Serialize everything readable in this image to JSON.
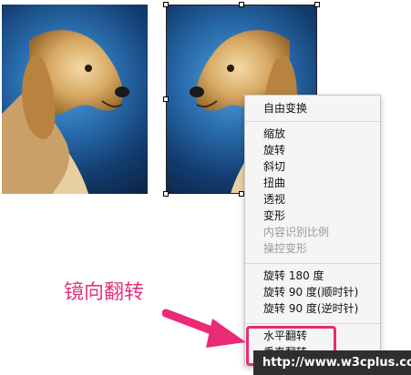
{
  "menu": {
    "items": [
      {
        "label": "自由变换",
        "disabled": false
      },
      {
        "label": "缩放",
        "disabled": false
      },
      {
        "label": "旋转",
        "disabled": false
      },
      {
        "label": "斜切",
        "disabled": false
      },
      {
        "label": "扭曲",
        "disabled": false
      },
      {
        "label": "透视",
        "disabled": false
      },
      {
        "label": "变形",
        "disabled": false
      },
      {
        "label": "内容识别比例",
        "disabled": true
      },
      {
        "label": "操控变形",
        "disabled": true
      },
      {
        "label": "旋转 180 度",
        "disabled": false
      },
      {
        "label": "旋转 90 度(顺时针)",
        "disabled": false
      },
      {
        "label": "旋转 90 度(逆时针)",
        "disabled": false
      },
      {
        "label": "水平翻转",
        "disabled": false
      },
      {
        "label": "垂直翻转",
        "disabled": false
      }
    ]
  },
  "annotation": {
    "text": "镜向翻转"
  },
  "watermark": {
    "text": "http://www.w3cplus.com"
  },
  "colors": {
    "accent": "#ea2a74",
    "annotation": "#e6327e"
  }
}
